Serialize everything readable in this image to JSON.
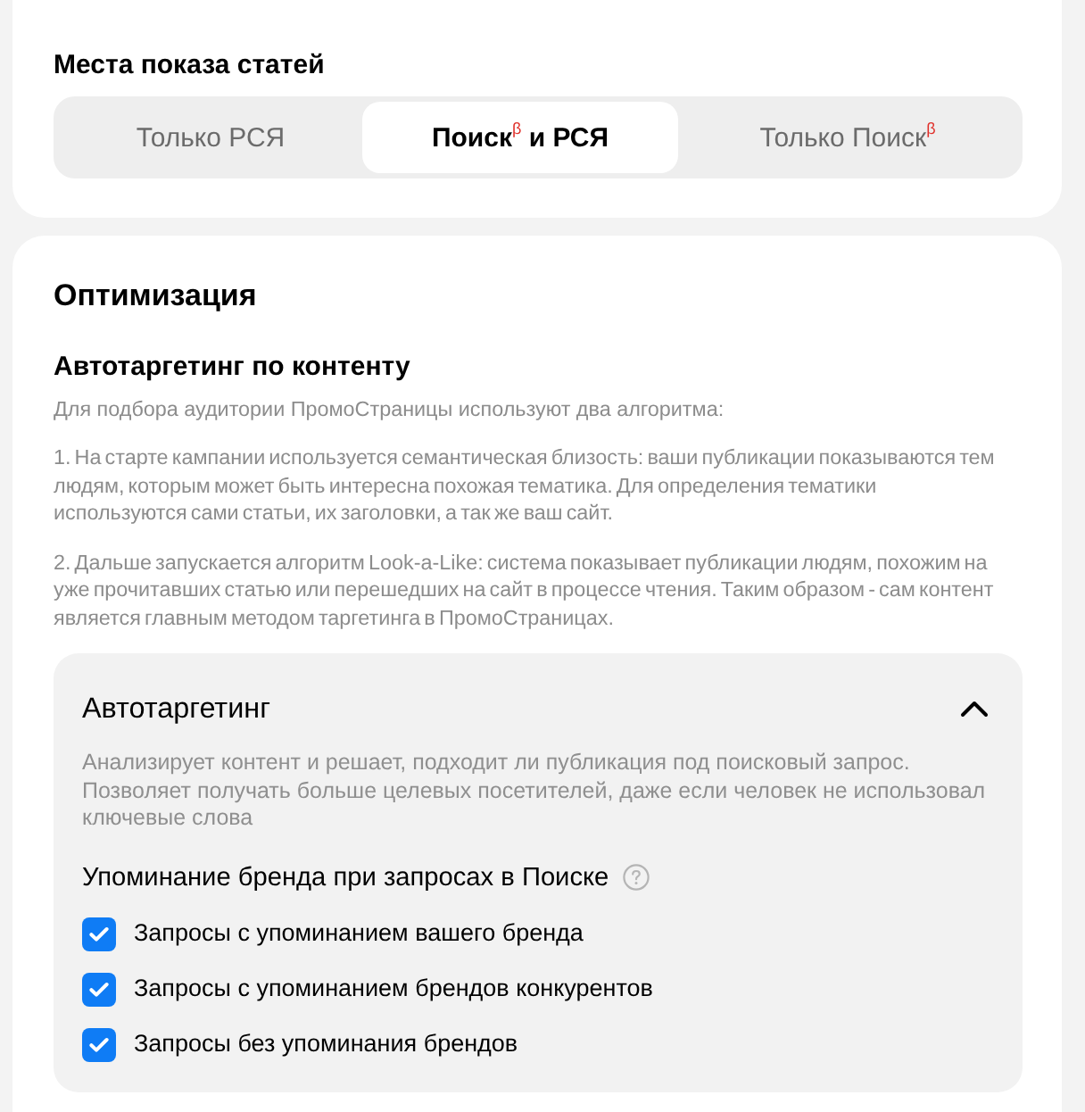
{
  "placements": {
    "title": "Места показа статей",
    "options": [
      {
        "label": "Только РСЯ",
        "selected": false
      },
      {
        "label": "Поиск$^{β}$ и РСЯ",
        "selected": true
      },
      {
        "label": "Только Поиск$^{β}$",
        "selected": false
      }
    ]
  },
  "optimization": {
    "title": "Оптимизация",
    "subtitle": "Автотаргетинг по контенту",
    "intro": "Для подбора аудитории ПромоСтраницы используют два алгоритма:",
    "paragraphs": [
      "1. На старте кампании используется семантическая близость: ваши публикации показываются тем людям, которым может быть интересна похожая тематика. Для определения тематики используются сами статьи, их заголовки, а так же ваш сайт.",
      "2. Дальше запускается алгоритм Look-a-Like: система показывает публикации людям, похожим на уже прочитавших статью или перешедших на сайт в процессе чтения. Таким образом - сам контент является главным методом таргетинга в ПромоСтраницах."
    ],
    "panel": {
      "title": "Автотаргетинг",
      "expanded": true,
      "description": "Анализирует контент и решает, подходит ли публикация под поисковый запрос. Позволяет получать больше целевых посетителей, даже если человек не использовал ключевые слова",
      "group_label": "Упоминание бренда при запросах в Поиске",
      "options": [
        {
          "label": "Запросы с упоминанием вашего бренда",
          "checked": true
        },
        {
          "label": "Запросы с упоминанием брендов конкурентов",
          "checked": true
        },
        {
          "label": "Запросы без упоминания брендов",
          "checked": true
        }
      ]
    }
  }
}
